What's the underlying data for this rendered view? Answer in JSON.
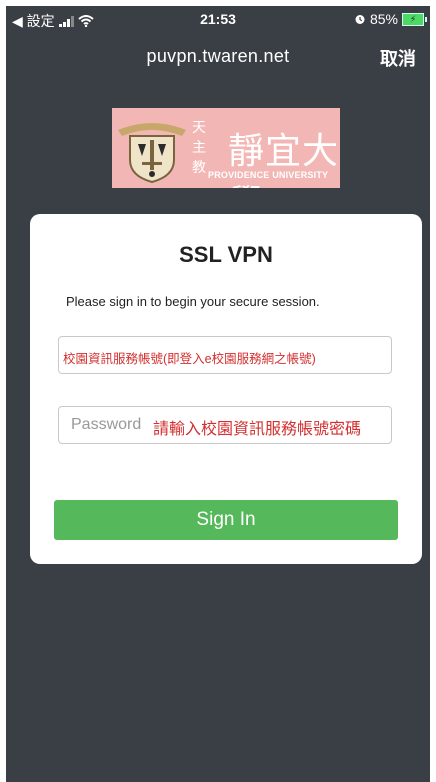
{
  "status_bar": {
    "back_label": "◀ 設定",
    "time": "21:53",
    "battery_percent": "85%"
  },
  "nav": {
    "title": "puvpn.twaren.net",
    "cancel_label": "取消"
  },
  "logo": {
    "name": "靜宜大學",
    "vertical": "天主教",
    "subtitle": "PROVIDENCE UNIVERSITY"
  },
  "login": {
    "title": "SSL VPN",
    "intro": "Please sign in to begin your secure session.",
    "username_value": "校園資訊服務帳號(即登入e校園服務網之帳號)",
    "password_placeholder": "Password",
    "password_hint": "請輸入校園資訊服務帳號密碼",
    "signin_label": "Sign In"
  },
  "colors": {
    "background": "#3a3e45",
    "logo_bg": "#f2b7b5",
    "hint_red": "#d32f2f",
    "button_green": "#55b85a"
  }
}
